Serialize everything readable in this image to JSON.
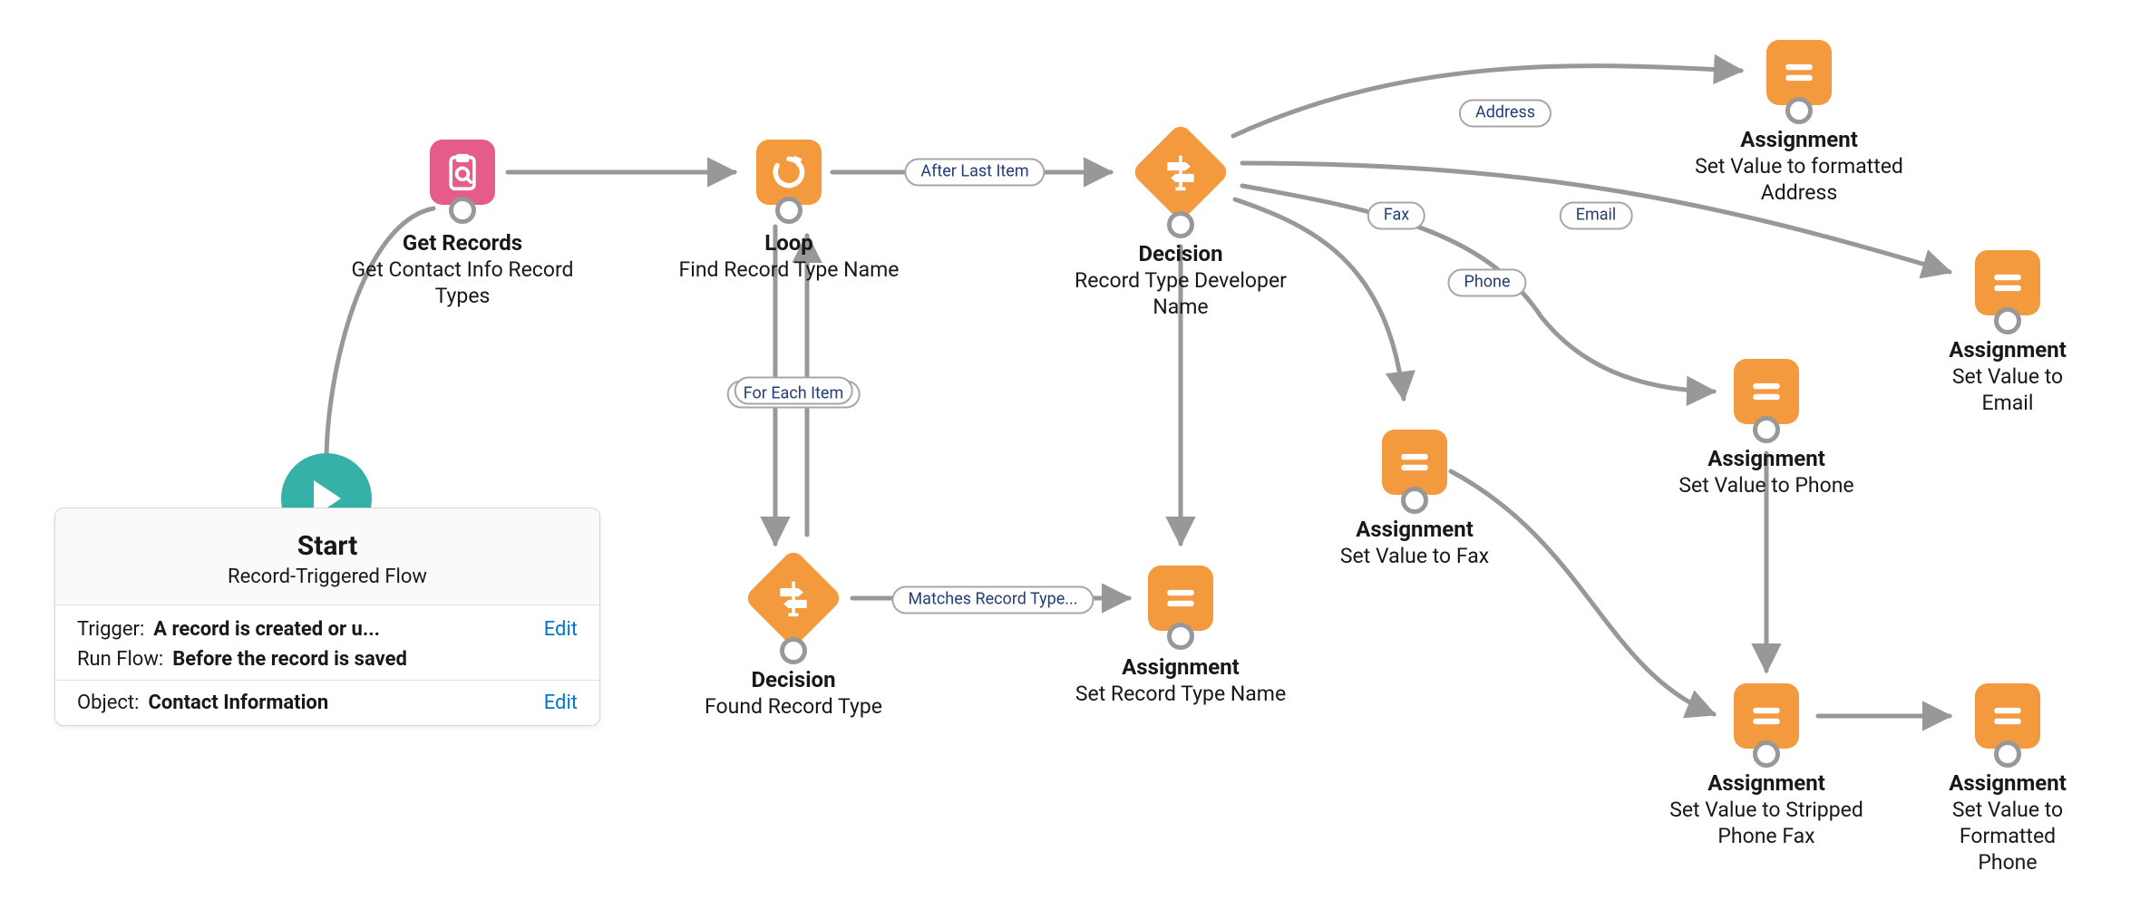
{
  "colors": {
    "orange": "#f3993e",
    "pink": "#e55c8a",
    "teal": "#35b1a7",
    "line": "#989898",
    "link": "#0176d3",
    "badgeText": "#243e75"
  },
  "start": {
    "title": "Start",
    "subtitle": "Record-Triggered Flow",
    "rows": {
      "trigger_label": "Trigger:",
      "trigger_value": "A record is created or u...",
      "runflow_label": "Run Flow:",
      "runflow_value": "Before the record is saved",
      "object_label": "Object:",
      "object_value": "Contact Information",
      "edit": "Edit"
    }
  },
  "nodes": {
    "getRecords": {
      "type": "Get Records",
      "name": "Get Contact Info Record Types"
    },
    "loop": {
      "type": "Loop",
      "name": "Find Record Type Name"
    },
    "decision1": {
      "type": "Decision",
      "name": "Found Record Type"
    },
    "assignSetRTName": {
      "type": "Assignment",
      "name": "Set Record Type Name"
    },
    "decision2": {
      "type": "Decision",
      "name": "Record Type Developer Name"
    },
    "assignFax": {
      "type": "Assignment",
      "name": "Set Value to Fax"
    },
    "assignPhone": {
      "type": "Assignment",
      "name": "Set Value to Phone"
    },
    "assignAddr": {
      "type": "Assignment",
      "name": "Set Value to formatted Address"
    },
    "assignEmail": {
      "type": "Assignment",
      "name": "Set Value to Email"
    },
    "assignStrip": {
      "type": "Assignment",
      "name": "Set Value to Stripped Phone Fax"
    },
    "assignFmtPh": {
      "type": "Assignment",
      "name": "Set Value to Formatted Phone"
    }
  },
  "connector_labels": {
    "afterLast": "After Last Item",
    "forEach": "For Each Item",
    "matchesRT": "Matches Record Type...",
    "address": "Address",
    "fax": "Fax",
    "phone": "Phone",
    "email": "Email"
  }
}
